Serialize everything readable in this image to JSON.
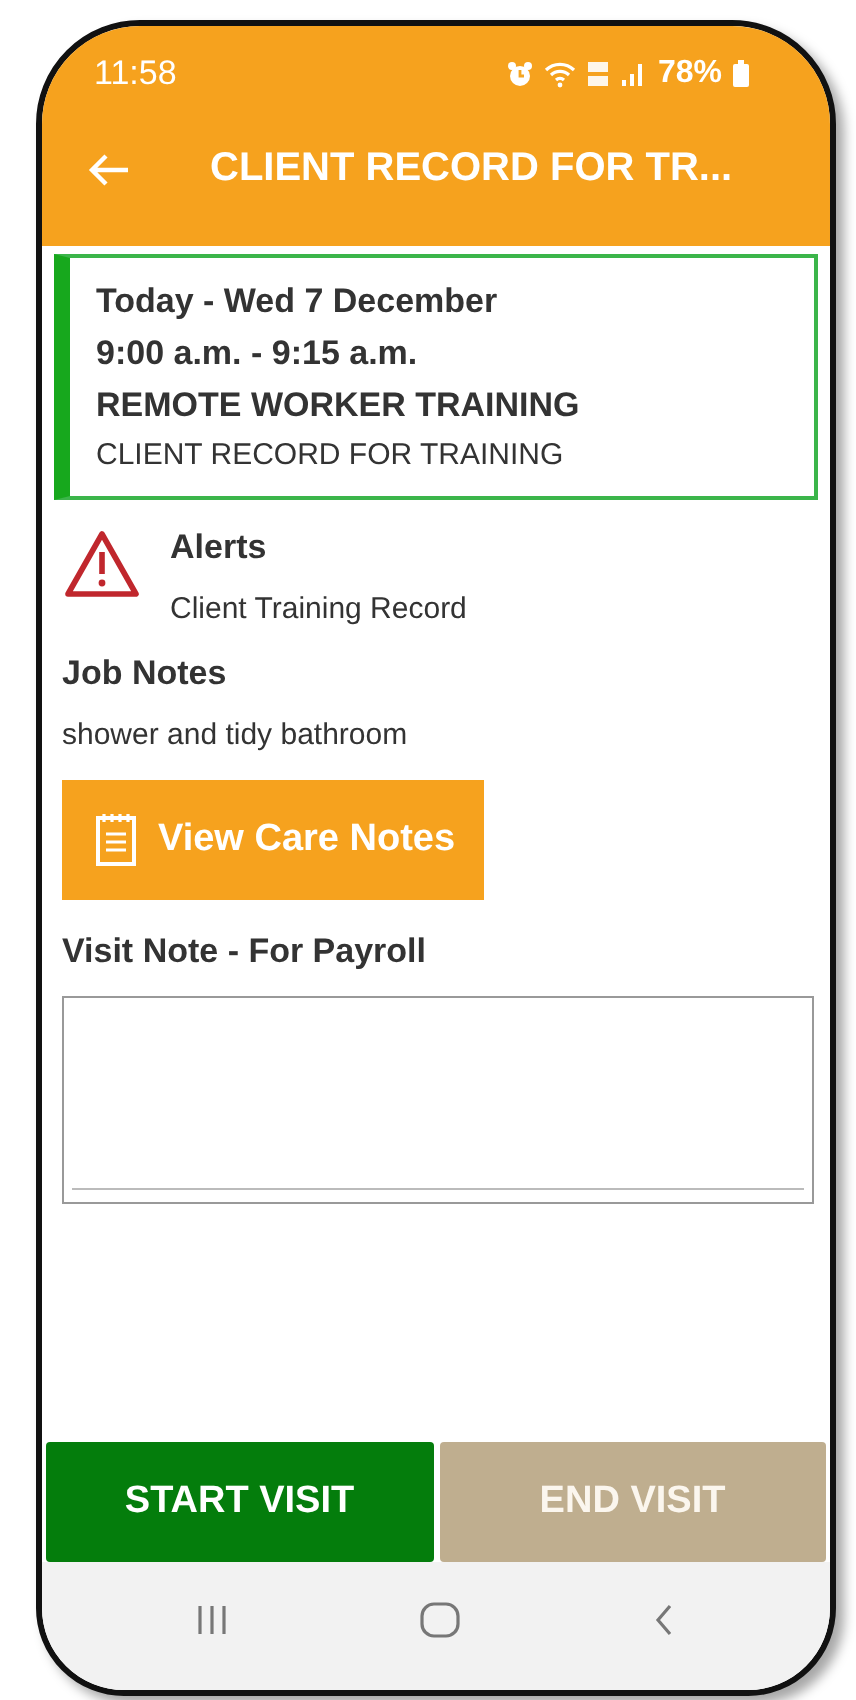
{
  "status_bar": {
    "time": "11:58",
    "battery": "78%"
  },
  "app_bar": {
    "title": "CLIENT RECORD FOR TR..."
  },
  "appointment": {
    "lines": [
      {
        "text": "Today - Wed 7 December",
        "kind": "bold"
      },
      {
        "text": "9:00 a.m. - 9:15 a.m.",
        "kind": "bold"
      },
      {
        "text": "REMOTE WORKER TRAINING",
        "kind": "bold"
      },
      {
        "text": "CLIENT RECORD FOR TRAINING",
        "kind": "plain"
      }
    ]
  },
  "alerts": {
    "title": "Alerts",
    "text": "Client Training Record"
  },
  "job_notes": {
    "title": "Job Notes",
    "text": "shower and tidy bathroom"
  },
  "care_notes_button": {
    "label": "View Care Notes"
  },
  "visit_note": {
    "label": "Visit Note - For Payroll"
  },
  "actions": [
    {
      "label": "START VISIT",
      "disabled": false
    },
    {
      "label": "END VISIT",
      "disabled": true
    }
  ]
}
